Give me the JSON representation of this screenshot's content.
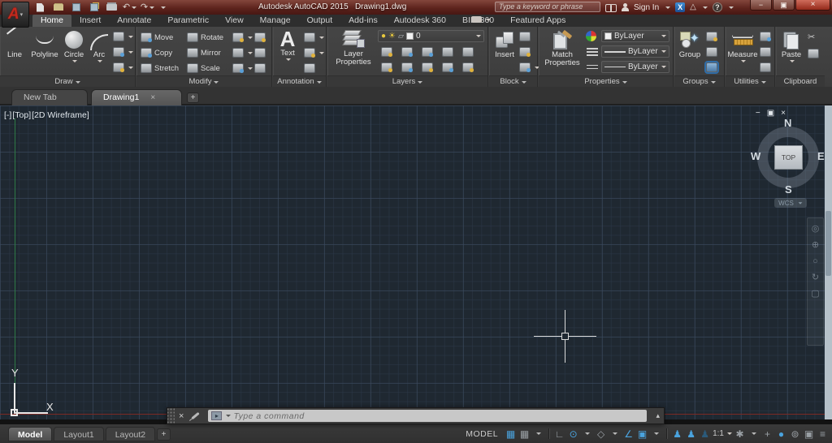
{
  "titlebar": {
    "title": "Autodesk AutoCAD 2015   Drawing1.dwg",
    "search_placeholder": "Type a keyword or phrase",
    "sign_in": "Sign In"
  },
  "icons": {
    "undo": "↶",
    "redo": "↷",
    "window_min": "−",
    "window_max": "▣",
    "window_close": "×",
    "exchange": "X",
    "comm_triangle": "△",
    "help": "?",
    "vp_min": "−",
    "vp_max": "▣",
    "vp_close": "×",
    "tab_close": "×",
    "cmd_close": "×",
    "cmd_recent": "▴",
    "cmd_prompt": "▸",
    "bulb": "●",
    "sun": "☀",
    "lock": "▱",
    "text_big": "A",
    "group_spark": "✦",
    "status": {
      "grid": "▦",
      "snap": "▦",
      "ortho": "∟",
      "polar": "⊙",
      "isodraft": "◇",
      "otrack": "∠",
      "osnap": "▣",
      "person": "♟",
      "gear": "✱",
      "plus": "+",
      "perf": "●",
      "isolate": "⊚",
      "clean": "▣",
      "menu": "≡"
    },
    "nav": [
      "◎",
      "⊕",
      "○",
      "↻",
      "▢"
    ]
  },
  "ribbon": {
    "tabs": [
      "Home",
      "Insert",
      "Annotate",
      "Parametric",
      "View",
      "Manage",
      "Output",
      "Add-ins",
      "Autodesk 360",
      "BIM 360",
      "Featured Apps"
    ],
    "draw": {
      "label": "Draw",
      "line": "Line",
      "polyline": "Polyline",
      "circle": "Circle",
      "arc": "Arc"
    },
    "modify": {
      "label": "Modify",
      "move": "Move",
      "copy": "Copy",
      "stretch": "Stretch",
      "rotate": "Rotate",
      "mirror": "Mirror",
      "scale": "Scale"
    },
    "annotation": {
      "label": "Annotation",
      "text": "Text"
    },
    "layers": {
      "label": "Layers",
      "big": "Layer Properties",
      "layer_value": "0"
    },
    "block": {
      "label": "Block",
      "big": "Insert"
    },
    "properties": {
      "label": "Properties",
      "big": "Match Properties",
      "color": "ByLayer",
      "lineweight": "ByLayer",
      "linetype": "ByLayer"
    },
    "groups": {
      "label": "Groups",
      "big": "Group"
    },
    "utilities": {
      "label": "Utilities",
      "big": "Measure"
    },
    "clipboard": {
      "label": "Clipboard",
      "big": "Paste"
    }
  },
  "file_tabs": {
    "new_tab": "New Tab",
    "drawing": "Drawing1",
    "add": "+"
  },
  "canvas": {
    "vp_controls": "[-]",
    "vp_view": "[Top]",
    "vp_visual": "[2D Wireframe]",
    "viewcube": {
      "n": "N",
      "s": "S",
      "e": "E",
      "w": "W",
      "top": "TOP",
      "wcs": "WCS"
    },
    "ucs_x": "X",
    "ucs_y": "Y"
  },
  "command_line": {
    "placeholder": "Type a command"
  },
  "statusbar": {
    "tabs": [
      "Model",
      "Layout1",
      "Layout2"
    ],
    "add": "+",
    "model": "MODEL",
    "scale": "1:1"
  }
}
